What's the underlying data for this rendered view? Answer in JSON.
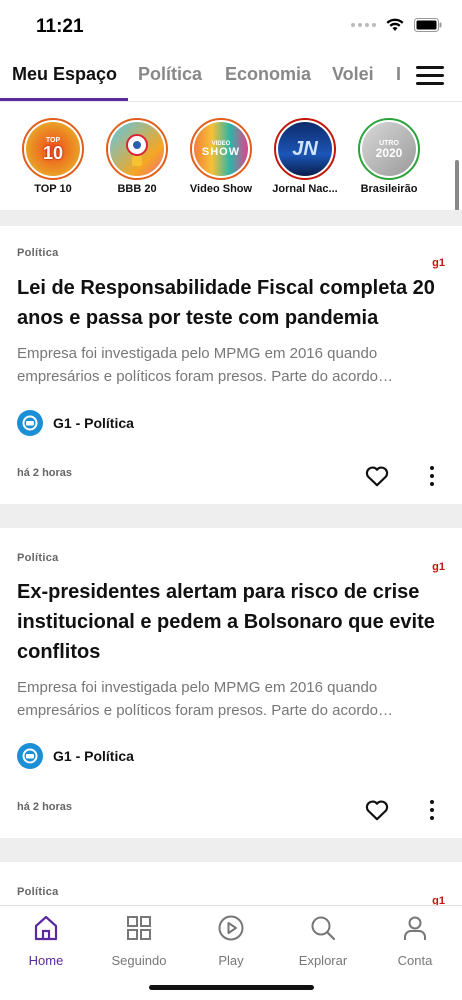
{
  "status": {
    "time": "11:21"
  },
  "tabs": [
    {
      "label": "Meu Espaço",
      "active": true
    },
    {
      "label": "Política"
    },
    {
      "label": "Economia"
    },
    {
      "label": "Volei"
    },
    {
      "label": "I"
    }
  ],
  "stories": [
    {
      "label": "TOP 10",
      "badge_top": "TOP",
      "badge_main": "10",
      "ring": "#e25e1c"
    },
    {
      "label": "BBB 20",
      "ring": "#e25e1c"
    },
    {
      "label": "Video Show",
      "badge_top": "VIDEO",
      "badge_main": "SHOW",
      "ring": "#e25e1c"
    },
    {
      "label": "Jornal Nac...",
      "badge_main": "JN",
      "ring": "#c4170c"
    },
    {
      "label": "Brasileirão",
      "badge_top": "UTRO",
      "badge_main": "2020",
      "ring": "#2aa33b"
    }
  ],
  "articles": [
    {
      "category": "Política",
      "brand": "g1",
      "title": "Lei de Responsabilidade Fiscal completa 20 anos e passa por teste com pandemia",
      "description": "Empresa foi investigada pelo MPMG em 2016 quando empresários e políticos foram presos. Parte do acordo…",
      "source": "G1 - Política",
      "time": "há 2 horas"
    },
    {
      "category": "Política",
      "brand": "g1",
      "title": "Ex-presidentes alertam para risco de crise institucional e pedem a Bolsonaro que evite conflitos",
      "description": "Empresa foi investigada pelo MPMG em 2016 quando empresários e políticos foram presos. Parte do acordo…",
      "source": "G1 - Política",
      "time": "há 2 horas"
    },
    {
      "category": "Política",
      "brand": "g1"
    }
  ],
  "nav": [
    {
      "label": "Home",
      "icon": "home-icon",
      "active": true
    },
    {
      "label": "Seguindo",
      "icon": "grid-icon"
    },
    {
      "label": "Play",
      "icon": "play-icon"
    },
    {
      "label": "Explorar",
      "icon": "search-icon"
    },
    {
      "label": "Conta",
      "icon": "user-icon"
    }
  ],
  "colors": {
    "accent": "#5b2aa0",
    "brand_red": "#c4170c",
    "source_blue": "#1a8fd6"
  }
}
